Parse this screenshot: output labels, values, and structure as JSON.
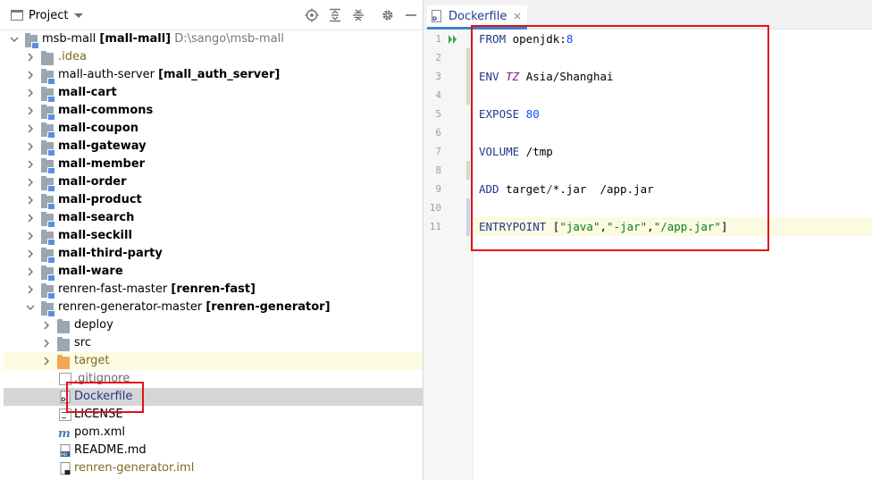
{
  "project_panel": {
    "title": "Project",
    "icons": [
      "locate-icon",
      "expand-all-icon",
      "collapse-all-icon",
      "gear-icon",
      "minimize-icon"
    ]
  },
  "tree": [
    {
      "label": "msb-mall",
      "bold_suffix": "[mall-mall]",
      "path": "D:\\sango\\msb-mall",
      "expanded": true,
      "icon": "module-folder-icon"
    },
    {
      "label": ".idea",
      "icon": "folder-icon"
    },
    {
      "label": "mall-auth-server",
      "bold_suffix": "[mall_auth_server]",
      "icon": "module-folder-icon"
    },
    {
      "label": "mall-cart",
      "bold": true,
      "icon": "module-folder-icon"
    },
    {
      "label": "mall-commons",
      "bold": true,
      "icon": "module-folder-icon"
    },
    {
      "label": "mall-coupon",
      "bold": true,
      "icon": "module-folder-icon"
    },
    {
      "label": "mall-gateway",
      "bold": true,
      "icon": "module-folder-icon"
    },
    {
      "label": "mall-member",
      "bold": true,
      "icon": "module-folder-icon"
    },
    {
      "label": "mall-order",
      "bold": true,
      "icon": "module-folder-icon"
    },
    {
      "label": "mall-product",
      "bold": true,
      "icon": "module-folder-icon"
    },
    {
      "label": "mall-search",
      "bold": true,
      "icon": "module-folder-icon"
    },
    {
      "label": "mall-seckill",
      "bold": true,
      "icon": "module-folder-icon"
    },
    {
      "label": "mall-third-party",
      "bold": true,
      "icon": "module-folder-icon"
    },
    {
      "label": "mall-ware",
      "bold": true,
      "icon": "module-folder-icon"
    },
    {
      "label": "renren-fast-master",
      "bold_suffix": "[renren-fast]",
      "icon": "module-folder-icon"
    },
    {
      "label": "renren-generator-master",
      "bold_suffix": "[renren-generator]",
      "expanded": true,
      "icon": "module-folder-icon"
    },
    {
      "label": "deploy",
      "icon": "folder-icon"
    },
    {
      "label": "src",
      "icon": "folder-icon"
    },
    {
      "label": "target",
      "icon": "folder-orange-icon"
    },
    {
      "label": ".gitignore",
      "icon": "gitignore-file-icon"
    },
    {
      "label": "Dockerfile",
      "icon": "dockerfile-icon",
      "selected": true
    },
    {
      "label": "LICENSE",
      "icon": "text-file-icon"
    },
    {
      "label": "pom.xml",
      "icon": "maven-icon"
    },
    {
      "label": "README.md",
      "icon": "markdown-icon"
    },
    {
      "label": "renren-generator.iml",
      "icon": "iml-file-icon"
    }
  ],
  "editor": {
    "tab_label": "Dockerfile",
    "tab_close": "×",
    "line_numbers": [
      "1",
      "2",
      "3",
      "4",
      "5",
      "6",
      "7",
      "8",
      "9",
      "10",
      "11"
    ],
    "lines": {
      "l1_kw": "FROM",
      "l1_rest": " openjdk:",
      "l1_num": "8",
      "l3_kw": "ENV",
      "l3_var": "TZ",
      "l3_rest": " Asia/Shanghai",
      "l5_kw": "EXPOSE",
      "l5_num": "80",
      "l7_kw": "VOLUME",
      "l7_rest": " /tmp",
      "l9_kw": "ADD",
      "l9_rest_a": " target",
      "l9_slash": "/",
      "l9_rest_b": "*.jar  /app.jar",
      "l11_kw": "ENTRYPOINT",
      "l11_open": " [",
      "l11_s1": "\"java\"",
      "l11_c1": ",",
      "l11_s2": "\"-jar\"",
      "l11_c2": ",",
      "l11_s3": "\"/app.jar\"",
      "l11_close": "]"
    }
  },
  "colors": {
    "highlight_box": "#e0121c",
    "selection": "#d5d5d5",
    "keyword": "#1f3a8a",
    "string": "#067d17",
    "number": "#1750eb",
    "env_var": "#871094"
  }
}
